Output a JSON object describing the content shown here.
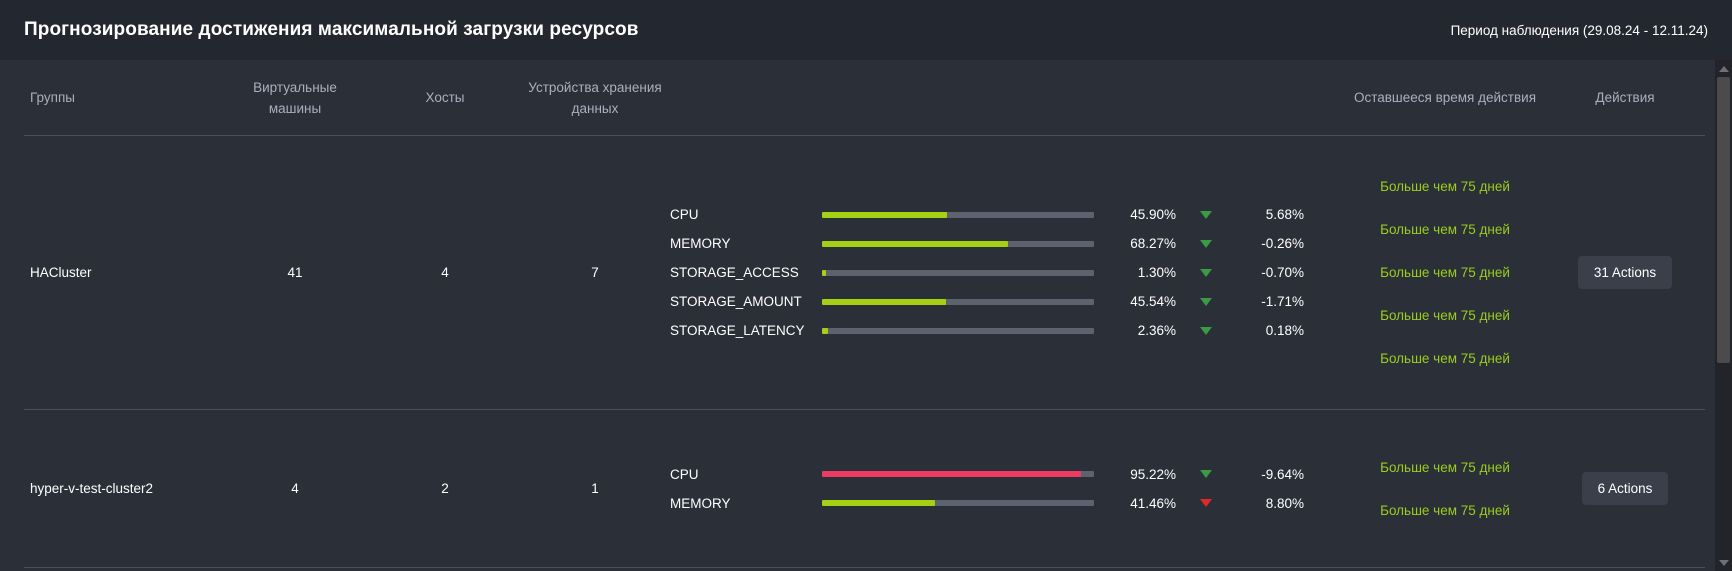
{
  "header": {
    "title": "Прогнозирование достижения максимальной загрузки ресурсов",
    "period": "Период наблюдения (29.08.24 - 12.11.24)"
  },
  "colors": {
    "accent_green": "#9acd1e",
    "bar_green": "#a5d013",
    "bar_red": "#ee3b63",
    "bar_track": "#5c636e",
    "arrow_down_green": "#3a9a46",
    "arrow_down_red": "#e02828",
    "panel_bg": "#2b2f38",
    "header_bg": "#23272f"
  },
  "table": {
    "columns": {
      "groups": "Группы",
      "vms": "Виртуальные машины",
      "hosts": "Хосты",
      "storage": "Устройства хранения данных",
      "remaining": "Оставшееся время действия",
      "actions": "Действия"
    },
    "rows": [
      {
        "group": "HACluster",
        "vms": "41",
        "hosts": "4",
        "storage": "7",
        "metrics": [
          {
            "name": "CPU",
            "value": "45.90%",
            "pct": 45.9,
            "bar_color": "#a5d013",
            "trend": "down",
            "trend_color": "#3a9a46",
            "delta": "5.68%"
          },
          {
            "name": "MEMORY",
            "value": "68.27%",
            "pct": 68.27,
            "bar_color": "#a5d013",
            "trend": "down",
            "trend_color": "#3a9a46",
            "delta": "-0.26%"
          },
          {
            "name": "STORAGE_ACCESS",
            "value": "1.30%",
            "pct": 1.3,
            "bar_color": "#a5d013",
            "trend": "down",
            "trend_color": "#3a9a46",
            "delta": "-0.70%"
          },
          {
            "name": "STORAGE_AMOUNT",
            "value": "45.54%",
            "pct": 45.54,
            "bar_color": "#a5d013",
            "trend": "down",
            "trend_color": "#3a9a46",
            "delta": "-1.71%"
          },
          {
            "name": "STORAGE_LATENCY",
            "value": "2.36%",
            "pct": 2.36,
            "bar_color": "#a5d013",
            "trend": "down",
            "trend_color": "#3a9a46",
            "delta": "0.18%"
          }
        ],
        "remaining": [
          "Больше чем 75 дней",
          "Больше чем 75 дней",
          "Больше чем 75 дней",
          "Больше чем 75 дней",
          "Больше чем 75 дней"
        ],
        "action_label": "31 Actions"
      },
      {
        "group": "hyper-v-test-cluster2",
        "vms": "4",
        "hosts": "2",
        "storage": "1",
        "metrics": [
          {
            "name": "CPU",
            "value": "95.22%",
            "pct": 95.22,
            "bar_color": "#ee3b63",
            "trend": "down",
            "trend_color": "#3a9a46",
            "delta": "-9.64%"
          },
          {
            "name": "MEMORY",
            "value": "41.46%",
            "pct": 41.46,
            "bar_color": "#a5d013",
            "trend": "down",
            "trend_color": "#e02828",
            "delta": "8.80%"
          }
        ],
        "remaining": [
          "Больше чем 75 дней",
          "Больше чем 75 дней"
        ],
        "action_label": "6 Actions"
      }
    ]
  },
  "scrollbar": {
    "up_icon": "triangle-up-icon",
    "down_icon": "triangle-down-icon",
    "thumb_position_pct": 0,
    "thumb_size_pct": 60
  }
}
